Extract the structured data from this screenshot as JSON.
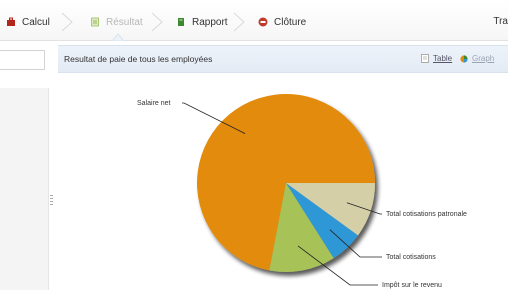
{
  "wizard": {
    "steps": [
      {
        "label": "Calcul",
        "state": "done",
        "icon": "briefcase-icon",
        "color": "#b3261e"
      },
      {
        "label": "Résultat",
        "state": "current",
        "icon": "document-icon",
        "color": "#7fb23f"
      },
      {
        "label": "Rapport",
        "state": "todo",
        "icon": "report-icon",
        "color": "#3b8a2f"
      },
      {
        "label": "Clôture",
        "state": "todo",
        "icon": "stop-icon",
        "color": "#c0392b"
      }
    ],
    "right_label": "Tra"
  },
  "panel": {
    "title": "Resultat de paie de tous les employées",
    "table_link": "Table",
    "graph_link": "Graph"
  },
  "chart_data": {
    "type": "pie",
    "title": "",
    "slices": [
      {
        "label": "Salaire net",
        "value": 72,
        "color": "#e38b0d"
      },
      {
        "label": "Impôt sur le revenu",
        "value": 12,
        "color": "#a7c257"
      },
      {
        "label": "Total cotisations",
        "value": 6,
        "color": "#2f97d6"
      },
      {
        "label": "Total cotisations patronale",
        "value": 10,
        "color": "#d4cfa6"
      }
    ],
    "legend": "callout-labels"
  }
}
